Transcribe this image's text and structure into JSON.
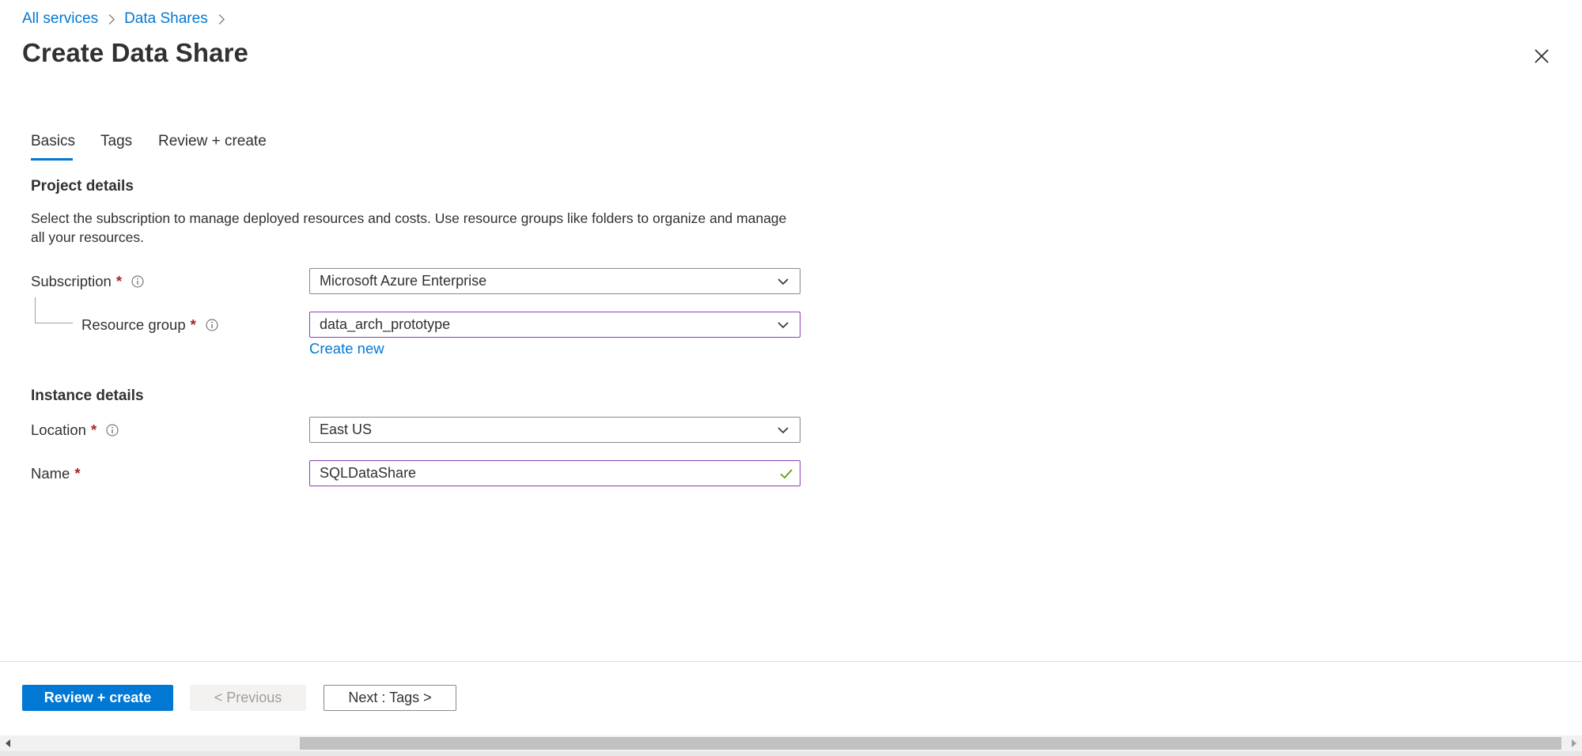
{
  "breadcrumb": {
    "items": [
      "All services",
      "Data Shares"
    ]
  },
  "page": {
    "title": "Create Data Share"
  },
  "tabs": [
    {
      "label": "Basics",
      "active": true
    },
    {
      "label": "Tags",
      "active": false
    },
    {
      "label": "Review + create",
      "active": false
    }
  ],
  "project_details": {
    "title": "Project details",
    "description": "Select the subscription to manage deployed resources and costs. Use resource groups like folders to organize and manage all your resources.",
    "subscription": {
      "label": "Subscription",
      "required": "*",
      "value": "Microsoft Azure Enterprise"
    },
    "resource_group": {
      "label": "Resource group",
      "required": "*",
      "value": "data_arch_prototype",
      "create_new_label": "Create new"
    }
  },
  "instance_details": {
    "title": "Instance details",
    "location": {
      "label": "Location",
      "required": "*",
      "value": "East US"
    },
    "name": {
      "label": "Name",
      "required": "*",
      "value": "SQLDataShare"
    }
  },
  "footer": {
    "review_create_label": "Review + create",
    "previous_label": "< Previous",
    "next_label": "Next : Tags >"
  },
  "icons": {
    "breadcrumb_separator": "chevron-right-icon",
    "close": "close-icon",
    "info": "info-icon",
    "dropdown": "chevron-down-icon",
    "valid": "checkmark-icon",
    "scroll_left": "scroll-left-arrow-icon",
    "scroll_right": "scroll-right-arrow-icon"
  },
  "colors": {
    "accent": "#0078d4",
    "required": "#a4262c",
    "focus_border": "#8a3fb5",
    "valid_check": "#57a300",
    "text": "#323130",
    "disabled_bg": "#f3f2f1",
    "disabled_text": "#a19f9d"
  }
}
